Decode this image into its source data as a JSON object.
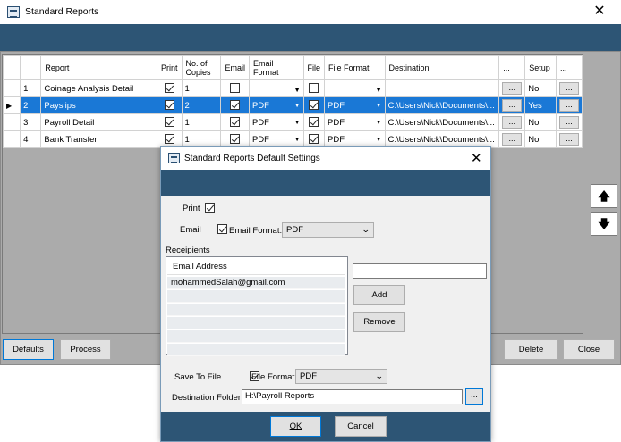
{
  "window": {
    "title": "Standard Reports",
    "close_symbol": "✕"
  },
  "grid": {
    "columns": [
      "Report",
      "Print",
      "No. of Copies",
      "Email",
      "Email Format",
      "File",
      "File Format",
      "Destination",
      "...",
      "Setup",
      "..."
    ],
    "rows": [
      {
        "num": "1",
        "report": "Coinage Analysis Detail",
        "print": true,
        "copies": "1",
        "email": false,
        "email_format": "",
        "file": false,
        "file_format": "",
        "destination": "",
        "setup": "No",
        "selected": false
      },
      {
        "num": "2",
        "report": "Payslips",
        "print": true,
        "copies": "2",
        "email": true,
        "email_format": "PDF",
        "file": true,
        "file_format": "PDF",
        "destination": "C:\\Users\\Nick\\Documents\\...",
        "setup": "Yes",
        "selected": true
      },
      {
        "num": "3",
        "report": "Payroll Detail",
        "print": true,
        "copies": "1",
        "email": true,
        "email_format": "PDF",
        "file": true,
        "file_format": "PDF",
        "destination": "C:\\Users\\Nick\\Documents\\...",
        "setup": "No",
        "selected": false
      },
      {
        "num": "4",
        "report": "Bank Transfer",
        "print": true,
        "copies": "1",
        "email": true,
        "email_format": "PDF",
        "file": true,
        "file_format": "PDF",
        "destination": "C:\\Users\\Nick\\Documents\\...",
        "setup": "No",
        "selected": false
      }
    ],
    "ellipsis_label": "...",
    "current_row_marker": "▶"
  },
  "side_buttons": {
    "up_icon": "🡅",
    "down_icon": "🡇"
  },
  "bottom_buttons": {
    "defaults": "Defaults",
    "process": "Process",
    "delete": "Delete",
    "close": "Close"
  },
  "dialog": {
    "title": "Standard Reports Default Settings",
    "close_symbol": "✕",
    "print_label": "Print",
    "print_checked": true,
    "email_label": "Email",
    "email_checked": true,
    "email_format_label": "Email Format:",
    "email_format_value": "PDF",
    "recipients_label": "Receipients",
    "recipients_header": "Email Address",
    "recipients": [
      "mohammedSalah@gmail.com"
    ],
    "new_recipient_value": "",
    "add_label": "Add",
    "remove_label": "Remove",
    "save_to_file_label": "Save To File",
    "save_to_file_checked": true,
    "file_format_label": "File Format:",
    "file_format_value": "PDF",
    "destination_label": "Destination Folder:",
    "destination_value": "H:\\Payroll Reports",
    "browse_label": "...",
    "ok_label": "OK",
    "cancel_label": "Cancel"
  },
  "colors": {
    "header_blue": "#2d5575",
    "selection_blue": "#1a78d6",
    "gray_bg": "#ababab"
  }
}
